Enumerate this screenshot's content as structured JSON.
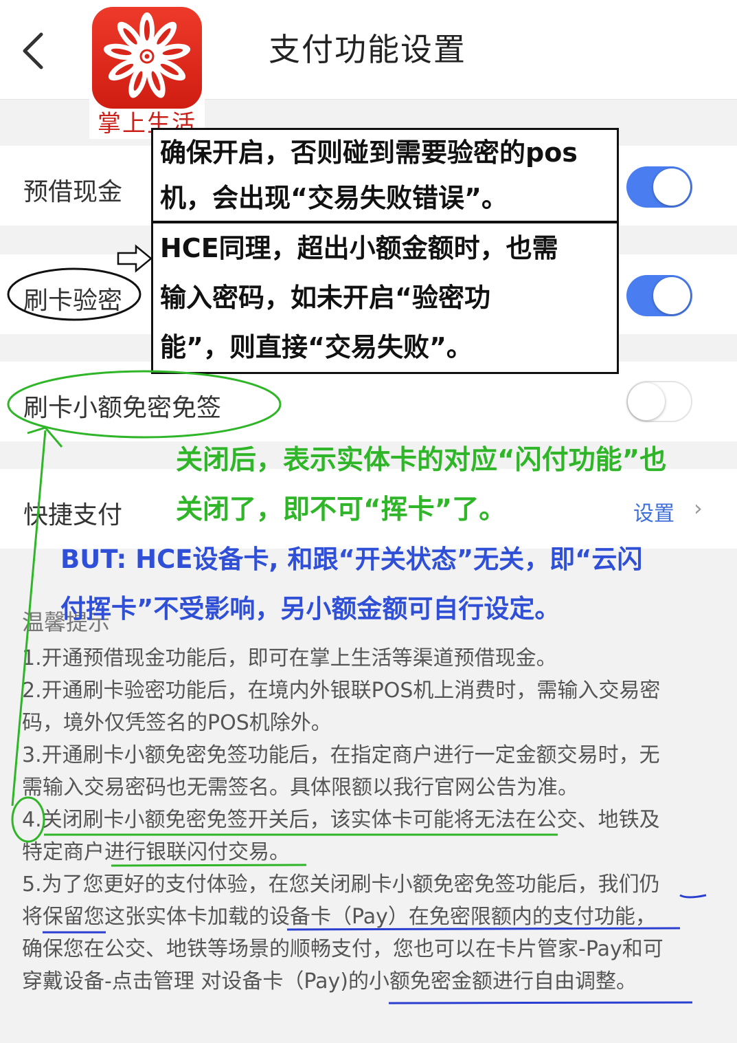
{
  "header": {
    "title": "支付功能设置"
  },
  "logo": {
    "caption": "掌上生活"
  },
  "settings": {
    "cash_advance": {
      "label": "预借现金",
      "enabled": true
    },
    "card_pin": {
      "label": "刷卡验密",
      "enabled": true
    },
    "small_amount": {
      "label": "刷卡小额免密免签",
      "enabled": false
    },
    "quick_pay": {
      "label": "快捷支付",
      "link": "设置"
    }
  },
  "notes": {
    "title": "温馨提示",
    "items": [
      "1.开通预借现金功能后，即可在掌上生活等渠道预借现金。",
      "2.开通刷卡验密功能后，在境内外银联POS机上消费时，需输入交易密",
      "码，境外仅凭签名的POS机除外。",
      "3.开通刷卡小额免密免签功能后，在指定商户进行一定金额交易时，无",
      "需输入交易密码也无需签名。具体限额以我行官网公告为准。",
      "4.关闭刷卡小额免密免签开关后，该实体卡可能将无法在公交、地铁及",
      "特定商户进行银联闪付交易。",
      "5.为了您更好的支付体验，在您关闭刷卡小额免密免签功能后，我们仍",
      "将保留您这张实体卡加载的设备卡（Pay）在免密限额内的支付功能，",
      "确保您在公交、地铁等场景的顺畅支付，您也可以在卡片管家-Pay和可",
      "穿戴设备-点击管理 对设备卡（Pay)的小额免密金额进行自由调整。"
    ]
  },
  "annotations": {
    "box1": [
      "确保开启，否则碰到需要验密的pos",
      "机，会出现“交易失败错误”。"
    ],
    "box2": [
      "HCE同理，超出小额金额时，也需",
      "输入密码，如未开启“验密功",
      "能”，则直接“交易失败”。"
    ],
    "green": [
      "关闭后，表示实体卡的对应“闪付功能”也",
      "关闭了，即不可“挥卡”了。"
    ],
    "blue": [
      "BUT: HCE设备卡, 和跟“开关状态”无关，即“云闪",
      "付挥卡”不受影响，另小额金额可自行设定。"
    ]
  },
  "colors": {
    "toggle_on": "#4a7df0",
    "annotation_green": "#2fb528",
    "annotation_blue": "#2f4fd6",
    "underline_blue": "#2a3fcf",
    "brand_red": "#d01d12"
  }
}
